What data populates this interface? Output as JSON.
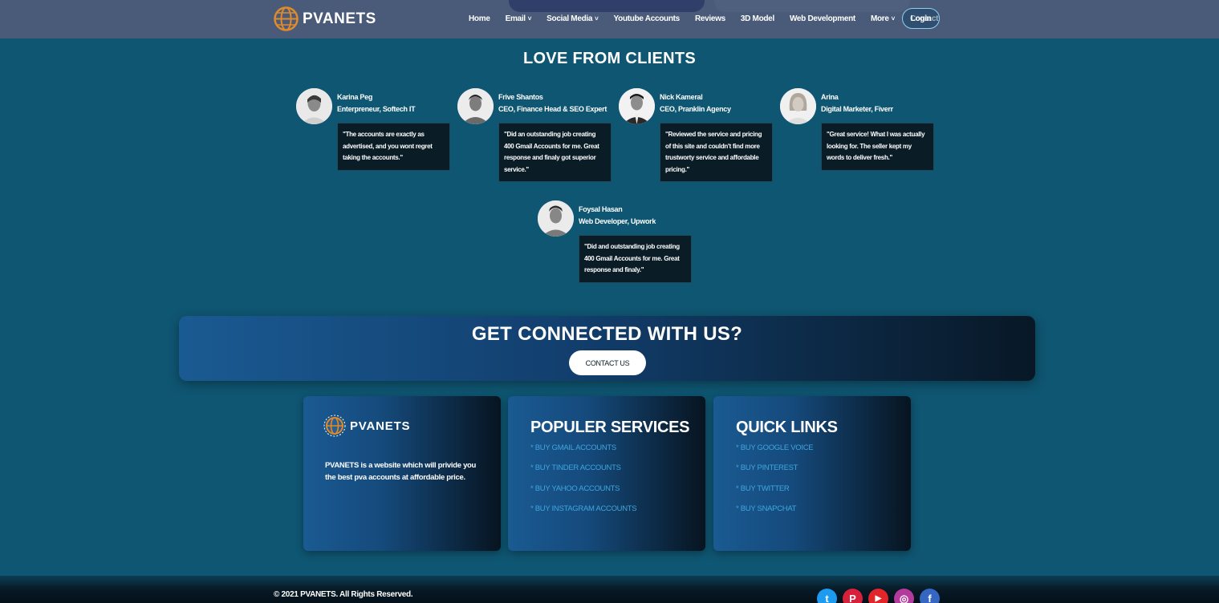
{
  "nav": {
    "brand": "PVANETS",
    "links": [
      "Home",
      "Email",
      "Social Media",
      "Youtube Accounts",
      "Reviews",
      "3D Model",
      "Web Development",
      "More",
      "Contact"
    ],
    "dropdown_marker": "˅",
    "login_label": "Login"
  },
  "testimonials": {
    "title": "LOVE FROM CLIENTS",
    "items": [
      {
        "name": "Karina Peg",
        "role": "Enterpreneur, Softech IT",
        "quote": "\"The accounts are exactly as advertised, and you wont regret taking the accounts.\""
      },
      {
        "name": "Frive Shantos",
        "role": "CEO, Finance Head & SEO Expert",
        "quote": "\"Did an outstanding job creating 400 Gmail Accounts for me. Great response and finaly got superior service.\""
      },
      {
        "name": "Nick Kameral",
        "role": "CEO, Pranklin Agency",
        "quote": "\"Reviewed the service and pricing of this site and couldn't find more trustworty service and affordable pricing.\""
      },
      {
        "name": "Arina",
        "role": "Digital Marketer, Fiverr",
        "quote": "\"Great service! What I was actually looking for. The seller kept my words to deliver fresh.\""
      },
      {
        "name": "Foysal Hasan",
        "role": "Web Developer, Upwork",
        "quote": "\"Did and outstanding job creating 400 Gmail Accounts for me. Great response and finaly.\""
      }
    ]
  },
  "cta": {
    "title": "GET CONNECTED WITH US?",
    "button_label": "CONTACT US"
  },
  "footer": {
    "about": {
      "brand": "PVANETS",
      "description": "PVANETS is a website which will privide you the best pva accounts at affordable price."
    },
    "services": {
      "heading": "POPULER SERVICES",
      "links": [
        "* BUY GMAIL ACCOUNTS",
        "* BUY TINDER ACCOUNTS",
        "* BUY YAHOO ACCOUNTS",
        "* BUY INSTAGRAM ACCOUNTS"
      ]
    },
    "quick_links": {
      "heading": "QUICK LINKS",
      "links": [
        "* BUY GOOGLE VOICE",
        "* BUY PINTEREST",
        "* BUY TWITTER",
        "* BUY SNAPCHAT"
      ]
    },
    "copyright": "© 2021 PVANETS. All Rights Reserved.",
    "socials": [
      {
        "icon": "twitter-icon",
        "glyph": "t",
        "color": "#1d9bf0"
      },
      {
        "icon": "pinterest-icon",
        "glyph": "P",
        "color": "#d9203b"
      },
      {
        "icon": "youtube-icon",
        "glyph": "▶",
        "color": "#e0262b"
      },
      {
        "icon": "instagram-icon",
        "glyph": "◎",
        "color": "#b43a9c"
      },
      {
        "icon": "facebook-icon",
        "glyph": "f",
        "color": "#3466c2"
      }
    ]
  },
  "colors": {
    "page_bg": "#0f5672",
    "navbar_bg": "#4a5b7a",
    "link_blue": "#3fa6de",
    "quote_bg": "#0a1c26"
  }
}
